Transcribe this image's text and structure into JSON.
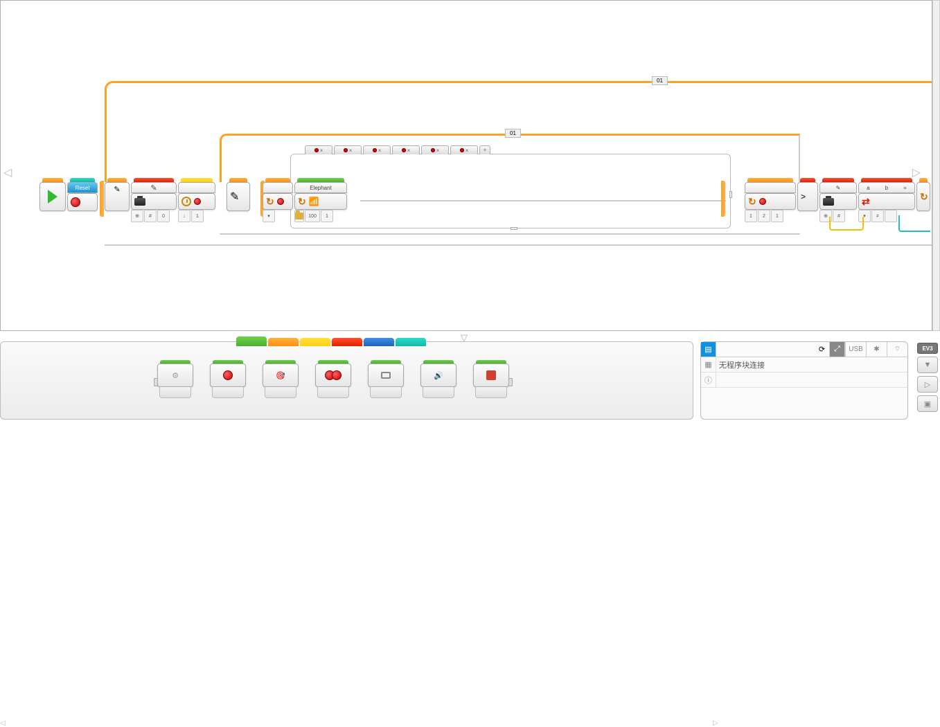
{
  "loops": {
    "outer_label": "01",
    "inner_label": "01"
  },
  "blocks": {
    "reset_label": "Reset",
    "elephant_label": "Elephant",
    "variable_block1": {
      "params": [
        "⊕",
        "#",
        "0"
      ]
    },
    "loop_start": {
      "params": [
        "↓",
        "1"
      ]
    },
    "sound_block": {
      "params": [
        "100",
        "1"
      ]
    },
    "loop_end_inner": {
      "params": [
        "1",
        "2",
        "1"
      ]
    },
    "compare_block": {
      "op": ">"
    },
    "variable_block2": {
      "params": [
        "⊕",
        "#"
      ]
    },
    "logic_block": {
      "params": [
        "a",
        "b",
        "="
      ],
      "extra": "≠"
    }
  },
  "switch": {
    "tabs_count": 6
  },
  "palette": {
    "categories": [
      "green",
      "orange",
      "yellow",
      "red",
      "blue",
      "teal"
    ]
  },
  "status": {
    "message": "无程序块连接",
    "conn_usb": "USB",
    "ev3_label": "EV3"
  }
}
